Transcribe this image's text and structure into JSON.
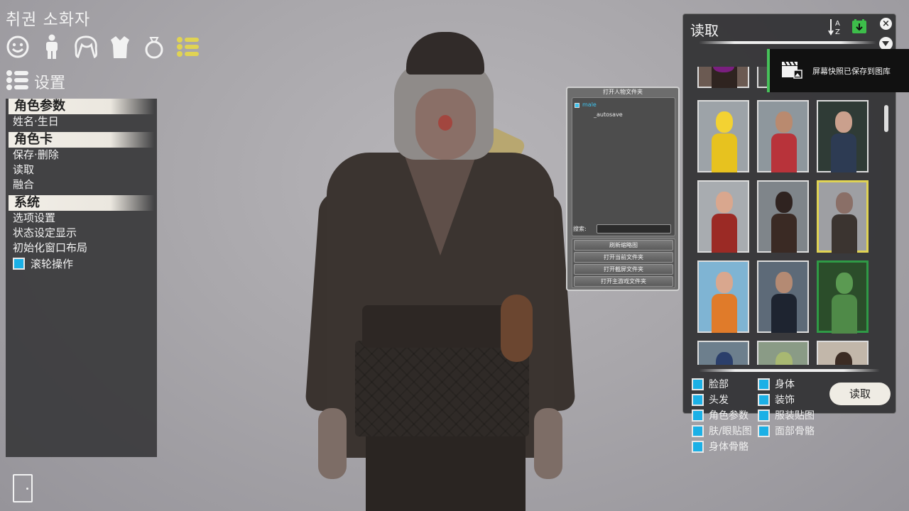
{
  "app": {
    "title": "취권 소화자"
  },
  "categories": [
    {
      "name": "face",
      "icon": "smiley-face-icon"
    },
    {
      "name": "body",
      "icon": "body-figure-icon"
    },
    {
      "name": "hair",
      "icon": "hair-icon"
    },
    {
      "name": "clothes",
      "icon": "shirt-icon"
    },
    {
      "name": "accessory",
      "icon": "ring-icon"
    },
    {
      "name": "system",
      "icon": "list-icon"
    }
  ],
  "settings_header": {
    "label": "设置"
  },
  "left_menu": {
    "sections": [
      {
        "header": "角色参数",
        "items": [
          "姓名·生日"
        ]
      },
      {
        "header": "角色卡",
        "items": [
          "保存·删除",
          "读取",
          "融合"
        ]
      },
      {
        "header": "系统",
        "items": [
          "选项设置",
          "状态设定显示",
          "初始化窗口布局"
        ]
      }
    ],
    "checkbox": {
      "label": "滚轮操作",
      "checked": true
    }
  },
  "folder_dialog": {
    "title": "打开人物文件夹",
    "tree": [
      "male",
      "_autosave"
    ],
    "search_label": "搜索:",
    "buttons": [
      "刷新缩略图",
      "打开当前文件夹",
      "打开截屏文件夹",
      "打开主游戏文件夹"
    ]
  },
  "load_panel": {
    "title": "读取",
    "toast": "屏幕快照已保存到图库",
    "options": [
      {
        "label": "脸部",
        "checked": true
      },
      {
        "label": "身体",
        "checked": true
      },
      {
        "label": "头发",
        "checked": true
      },
      {
        "label": "装饰",
        "checked": true
      },
      {
        "label": "角色参数",
        "checked": true
      },
      {
        "label": "服装贴图",
        "checked": true
      },
      {
        "label": "肤/眼贴图",
        "checked": true
      },
      {
        "label": "面部骨骼",
        "checked": true
      },
      {
        "label": "身体骨骼",
        "checked": true
      }
    ],
    "load_button": "读取",
    "colors": {
      "checkbox": "#1bb0e6",
      "selected_border": "#e0d353",
      "toast_accent": "#47c25a"
    }
  }
}
